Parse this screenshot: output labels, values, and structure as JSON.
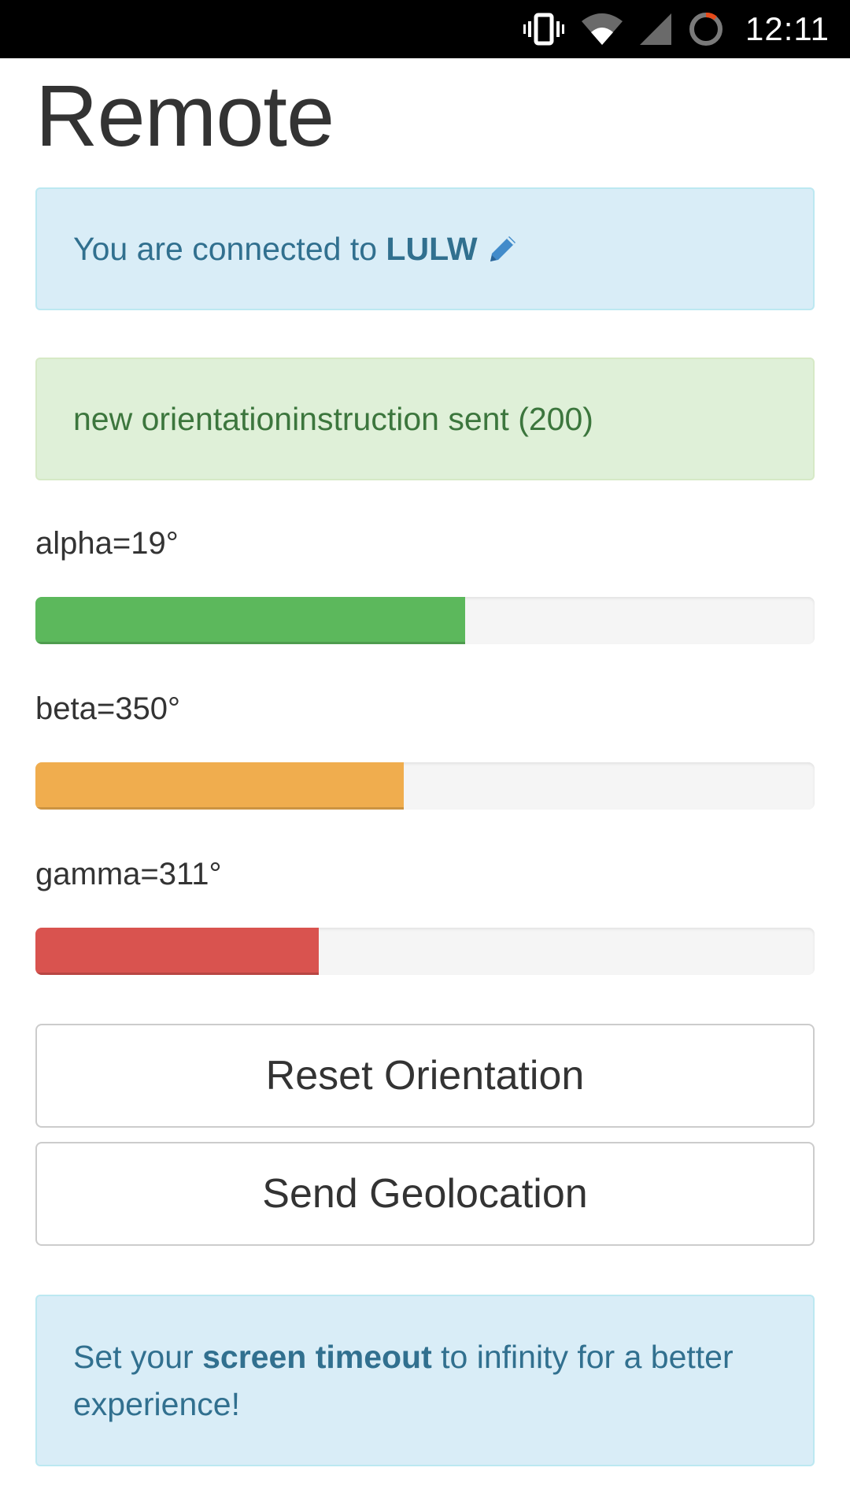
{
  "status_bar": {
    "time": "12:11",
    "icons": [
      "vibrate-icon",
      "wifi-icon",
      "signal-icon",
      "loading-icon"
    ]
  },
  "page": {
    "title": "Remote"
  },
  "connection_alert": {
    "prefix": "You are connected to ",
    "device_name": "LULW",
    "icon": "pencil-icon"
  },
  "status_alert": {
    "message": "new orientationinstruction sent (200)"
  },
  "orientation": [
    {
      "label": "alpha=19°",
      "fill_fraction": 0.552,
      "color": "#5cb85c"
    },
    {
      "label": "beta=350°",
      "fill_fraction": 0.473,
      "color": "#f0ad4e"
    },
    {
      "label": "gamma=311°",
      "fill_fraction": 0.364,
      "color": "#d9534f"
    }
  ],
  "buttons": {
    "reset_label": "Reset Orientation",
    "geolocation_label": "Send Geolocation"
  },
  "timeout_alert": {
    "prefix": "Set your ",
    "emphasis": "screen timeout",
    "suffix": " to infinity for a better experience!"
  },
  "colors": {
    "info_bg": "#d9edf7",
    "info_text": "#31708f",
    "success_bg": "#dff0d8",
    "success_text": "#3c763d"
  }
}
